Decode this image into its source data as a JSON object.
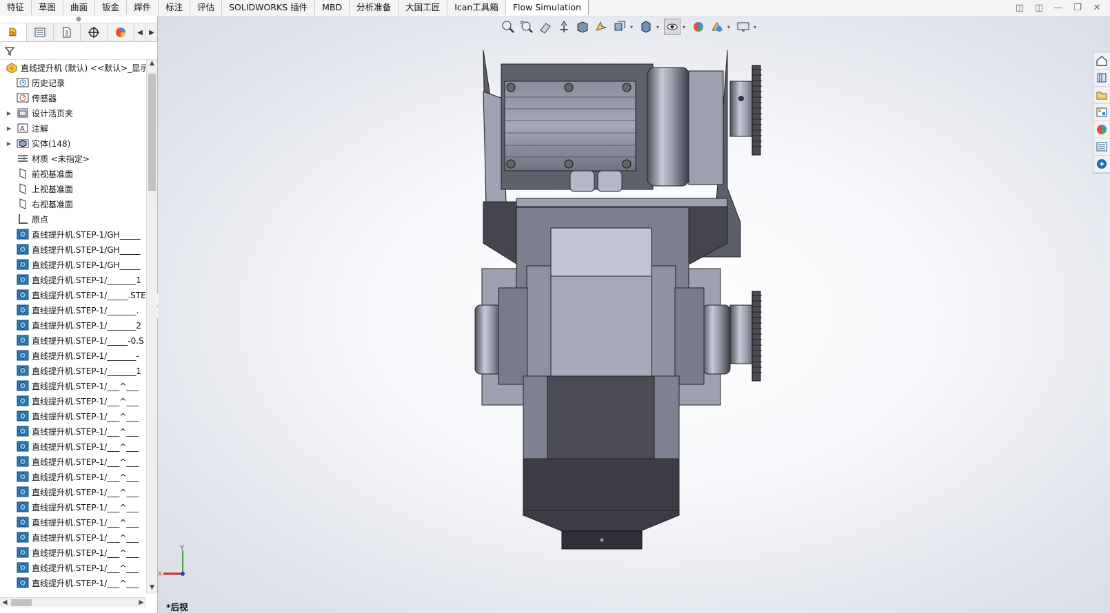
{
  "command_tabs": [
    "特征",
    "草图",
    "曲面",
    "钣金",
    "焊件",
    "标注",
    "评估",
    "SOLIDWORKS 插件",
    "MBD",
    "分析准备",
    "大国工匠",
    "Ican工具箱",
    "Flow Simulation"
  ],
  "active_tab_index": 12,
  "window_controls": [
    "restore-left",
    "restore-right",
    "minimize",
    "maximize",
    "close"
  ],
  "feature_manager": {
    "panel_tabs": [
      "featuremanager-tree",
      "property-manager",
      "configuration-manager",
      "dimxpert-manager",
      "display-manager"
    ],
    "root_label": "直线提升机 (默认) <<默认>_显示状态",
    "items": [
      {
        "label": "历史记录",
        "icon": "history-folder",
        "expandable": false
      },
      {
        "label": "传感器",
        "icon": "sensor-folder",
        "expandable": false
      },
      {
        "label": "设计活页夹",
        "icon": "design-binder",
        "expandable": true
      },
      {
        "label": "注解",
        "icon": "annotations",
        "expandable": true
      },
      {
        "label": "实体(148)",
        "icon": "solid-bodies",
        "expandable": true
      },
      {
        "label": "材质 <未指定>",
        "icon": "material",
        "expandable": false
      },
      {
        "label": "前视基准面",
        "icon": "plane",
        "expandable": false
      },
      {
        "label": "上视基准面",
        "icon": "plane",
        "expandable": false
      },
      {
        "label": "右视基准面",
        "icon": "plane",
        "expandable": false
      },
      {
        "label": "原点",
        "icon": "origin",
        "expandable": false
      },
      {
        "label": "直线提升机.STEP-1/GH_____",
        "icon": "part",
        "expandable": false
      },
      {
        "label": "直线提升机.STEP-1/GH_____",
        "icon": "part",
        "expandable": false
      },
      {
        "label": "直线提升机.STEP-1/GH_____",
        "icon": "part",
        "expandable": false
      },
      {
        "label": "直线提升机.STEP-1/_______1",
        "icon": "part",
        "expandable": false
      },
      {
        "label": "直线提升机.STEP-1/_____.STE",
        "icon": "part",
        "expandable": false
      },
      {
        "label": "直线提升机.STEP-1/_______.",
        "icon": "part",
        "expandable": false
      },
      {
        "label": "直线提升机.STEP-1/_______2",
        "icon": "part",
        "expandable": false
      },
      {
        "label": "直线提升机.STEP-1/_____-0.S",
        "icon": "part",
        "expandable": false
      },
      {
        "label": "直线提升机.STEP-1/_______-",
        "icon": "part",
        "expandable": false
      },
      {
        "label": "直线提升机.STEP-1/_______1",
        "icon": "part",
        "expandable": false
      },
      {
        "label": "直线提升机.STEP-1/___^___",
        "icon": "part",
        "expandable": false
      },
      {
        "label": "直线提升机.STEP-1/___^___",
        "icon": "part",
        "expandable": false
      },
      {
        "label": "直线提升机.STEP-1/___^___",
        "icon": "part",
        "expandable": false
      },
      {
        "label": "直线提升机.STEP-1/___^___",
        "icon": "part",
        "expandable": false
      },
      {
        "label": "直线提升机.STEP-1/___^___",
        "icon": "part",
        "expandable": false
      },
      {
        "label": "直线提升机.STEP-1/___^___",
        "icon": "part",
        "expandable": false
      },
      {
        "label": "直线提升机.STEP-1/___^___",
        "icon": "part",
        "expandable": false
      },
      {
        "label": "直线提升机.STEP-1/___^___",
        "icon": "part",
        "expandable": false
      },
      {
        "label": "直线提升机.STEP-1/___^___",
        "icon": "part",
        "expandable": false
      },
      {
        "label": "直线提升机.STEP-1/___^___",
        "icon": "part",
        "expandable": false
      },
      {
        "label": "直线提升机.STEP-1/___^___",
        "icon": "part",
        "expandable": false
      },
      {
        "label": "直线提升机.STEP-1/___^___",
        "icon": "part",
        "expandable": false
      },
      {
        "label": "直线提升机.STEP-1/___^___",
        "icon": "part",
        "expandable": false
      },
      {
        "label": "直线提升机.STEP-1/___^___",
        "icon": "part",
        "expandable": false
      }
    ]
  },
  "heads_up_toolbar": [
    "zoom-to-fit-icon",
    "zoom-to-area-icon",
    "previous-view-icon",
    "section-view-icon",
    "dynamic-annotation-icon",
    "view-orientation-icon",
    "display-style-icon",
    "hide-show-items-icon",
    "edit-appearance-icon",
    "apply-scene-icon",
    "view-settings-icon"
  ],
  "task_pane": [
    "home-icon",
    "design-library-icon",
    "file-explorer-icon",
    "view-palette-icon",
    "appearances-icon",
    "custom-properties-icon",
    "solidworks-forum-icon"
  ],
  "viewport": {
    "view_label": "*后视",
    "triad": {
      "x": "X",
      "y": "Y"
    }
  },
  "colors": {
    "accent_blue": "#1f6fb5",
    "part_icon": "#2a7fbf",
    "metal_light": "#b4b7c8",
    "metal_mid": "#8e91a3",
    "metal_dark": "#3f4048"
  }
}
